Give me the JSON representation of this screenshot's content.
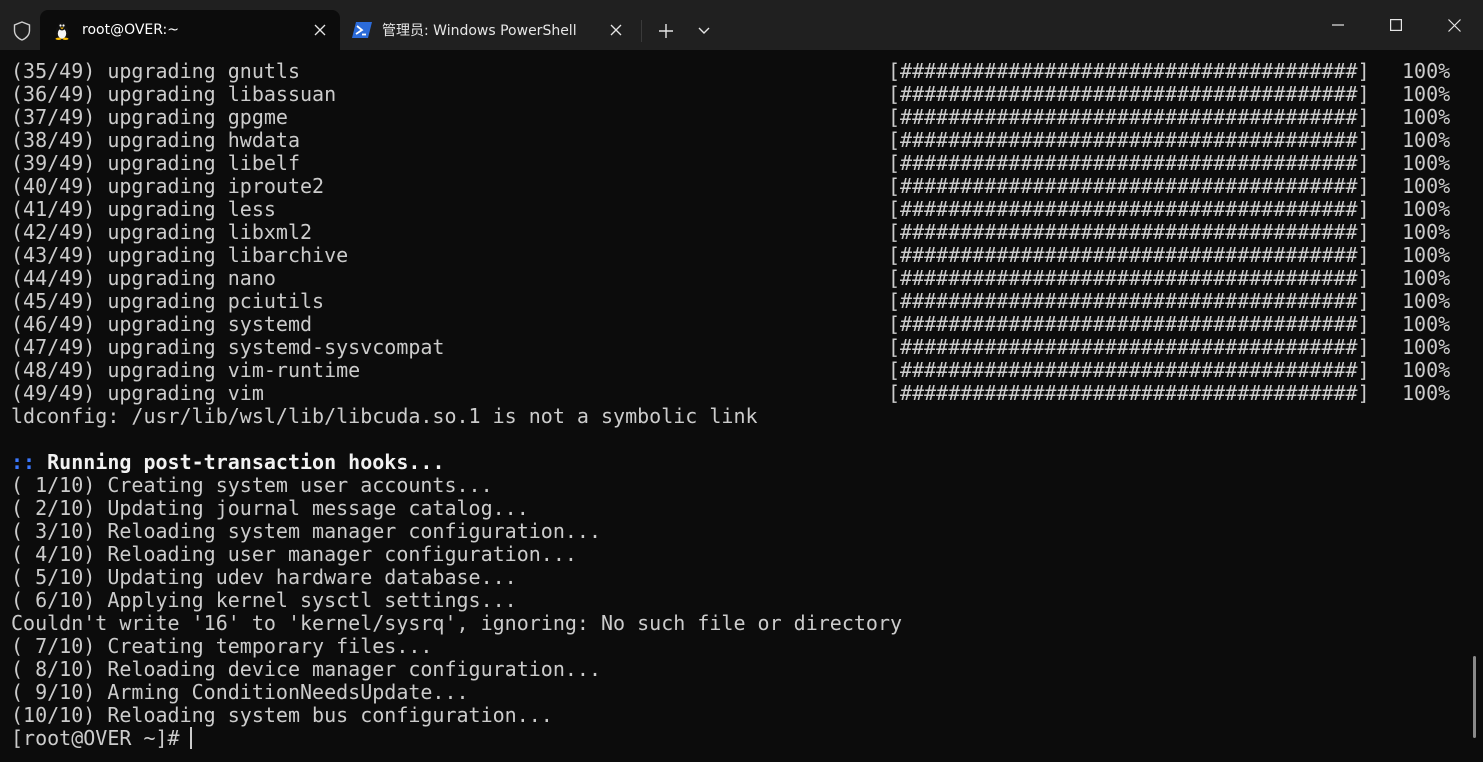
{
  "titlebar": {
    "tabs": [
      {
        "title": "root@OVER:~",
        "icon": "linux-penguin-icon",
        "active": true
      },
      {
        "title": "管理员: Windows PowerShell",
        "icon": "powershell-icon",
        "active": false
      }
    ]
  },
  "colors": {
    "background": "#0c0c0c",
    "titlebar": "#202020",
    "text": "#cccccc",
    "prefix_blue": "#3b78ff"
  },
  "terminal": {
    "upgrades": [
      {
        "label": "(35/49) upgrading gnutls",
        "bar": "[######################################]",
        "pct": "100%"
      },
      {
        "label": "(36/49) upgrading libassuan",
        "bar": "[######################################]",
        "pct": "100%"
      },
      {
        "label": "(37/49) upgrading gpgme",
        "bar": "[######################################]",
        "pct": "100%"
      },
      {
        "label": "(38/49) upgrading hwdata",
        "bar": "[######################################]",
        "pct": "100%"
      },
      {
        "label": "(39/49) upgrading libelf",
        "bar": "[######################################]",
        "pct": "100%"
      },
      {
        "label": "(40/49) upgrading iproute2",
        "bar": "[######################################]",
        "pct": "100%"
      },
      {
        "label": "(41/49) upgrading less",
        "bar": "[######################################]",
        "pct": "100%"
      },
      {
        "label": "(42/49) upgrading libxml2",
        "bar": "[######################################]",
        "pct": "100%"
      },
      {
        "label": "(43/49) upgrading libarchive",
        "bar": "[######################################]",
        "pct": "100%"
      },
      {
        "label": "(44/49) upgrading nano",
        "bar": "[######################################]",
        "pct": "100%"
      },
      {
        "label": "(45/49) upgrading pciutils",
        "bar": "[######################################]",
        "pct": "100%"
      },
      {
        "label": "(46/49) upgrading systemd",
        "bar": "[######################################]",
        "pct": "100%"
      },
      {
        "label": "(47/49) upgrading systemd-sysvcompat",
        "bar": "[######################################]",
        "pct": "100%"
      },
      {
        "label": "(48/49) upgrading vim-runtime",
        "bar": "[######################################]",
        "pct": "100%"
      },
      {
        "label": "(49/49) upgrading vim",
        "bar": "[######################################]",
        "pct": "100%"
      }
    ],
    "ldconfig": "ldconfig: /usr/lib/wsl/lib/libcuda.so.1 is not a symbolic link",
    "hooks_prefix": "::",
    "hooks_title": "Running post-transaction hooks...",
    "hooks": [
      "( 1/10) Creating system user accounts...",
      "( 2/10) Updating journal message catalog...",
      "( 3/10) Reloading system manager configuration...",
      "( 4/10) Reloading user manager configuration...",
      "( 5/10) Updating udev hardware database...",
      "( 6/10) Applying kernel sysctl settings...",
      "Couldn't write '16' to 'kernel/sysrq', ignoring: No such file or directory",
      "( 7/10) Creating temporary files...",
      "( 8/10) Reloading device manager configuration...",
      "( 9/10) Arming ConditionNeedsUpdate...",
      "(10/10) Reloading system bus configuration..."
    ],
    "prompt": "[root@OVER ~]#"
  }
}
